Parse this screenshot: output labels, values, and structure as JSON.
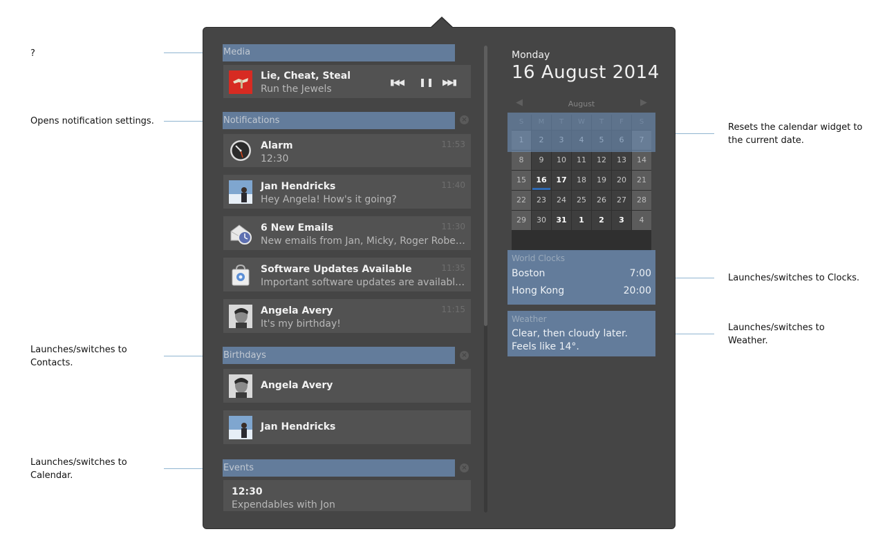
{
  "annotations": {
    "media": "?",
    "notifications": "Opens notification settings.",
    "birthdays_line1": "Launches/switches to",
    "birthdays_line2": "Contacts.",
    "events_line1": "Launches/switches to",
    "events_line2": "Calendar.",
    "calendar_line1": "Resets the calendar widget to",
    "calendar_line2": "the current date.",
    "clocks": "Launches/switches to Clocks.",
    "weather_line1": "Launches/switches to",
    "weather_line2": "Weather."
  },
  "media": {
    "section_title": "Media",
    "track_title": "Lie, Cheat, Steal",
    "artist": "Run the Jewels",
    "prev_icon": "skip-previous-icon",
    "pause_icon": "pause-icon",
    "next_icon": "skip-next-icon"
  },
  "notifications": {
    "section_title": "Notifications",
    "items": [
      {
        "title": "Alarm",
        "body": "12:30",
        "time": "11:53",
        "icon": "alarm-clock-icon"
      },
      {
        "title": "Jan Hendricks",
        "body": "Hey Angela! How's it going?",
        "time": "11:40",
        "icon": "avatar"
      },
      {
        "title": "6 New Emails",
        "body": "New emails from Jan, Micky, Roger Robert…",
        "time": "11:30",
        "icon": "mail-icon"
      },
      {
        "title": "Software Updates Available",
        "body": "Important software updates are available t…",
        "time": "11:35",
        "icon": "software-bag-icon"
      },
      {
        "title": "Angela Avery",
        "body": "It's my birthday!",
        "time": "11:15",
        "icon": "avatar"
      }
    ]
  },
  "birthdays": {
    "section_title": "Birthdays",
    "items": [
      "Angela Avery",
      "Jan Hendricks"
    ]
  },
  "events": {
    "section_title": "Events",
    "items": [
      {
        "time": "12:30",
        "title": "Expendables with Jon"
      }
    ]
  },
  "date": {
    "weekday": "Monday",
    "full_date": "16 August 2014"
  },
  "calendar": {
    "month": "August",
    "weekdays": [
      "S",
      "M",
      "T",
      "W",
      "T",
      "F",
      "S"
    ],
    "weeks": [
      [
        "1",
        "2",
        "3",
        "4",
        "5",
        "6",
        "7"
      ],
      [
        "8",
        "9",
        "10",
        "11",
        "12",
        "13",
        "14"
      ],
      [
        "15",
        "16",
        "17",
        "18",
        "19",
        "20",
        "21"
      ],
      [
        "22",
        "23",
        "24",
        "25",
        "26",
        "27",
        "28"
      ],
      [
        "29",
        "30",
        "31",
        "1",
        "2",
        "3",
        "4"
      ]
    ],
    "today": "16"
  },
  "world_clocks": {
    "title": "World Clocks",
    "items": [
      {
        "city": "Boston",
        "time": "7:00"
      },
      {
        "city": "Hong Kong",
        "time": "20:00"
      }
    ]
  },
  "weather": {
    "title": "Weather",
    "forecast": "Clear, then cloudy later. Feels like 14°."
  },
  "colors": {
    "panel": "#454545",
    "card": "#525252",
    "highlight": "#6f92bc",
    "today_marker": "#2f6bb5"
  }
}
